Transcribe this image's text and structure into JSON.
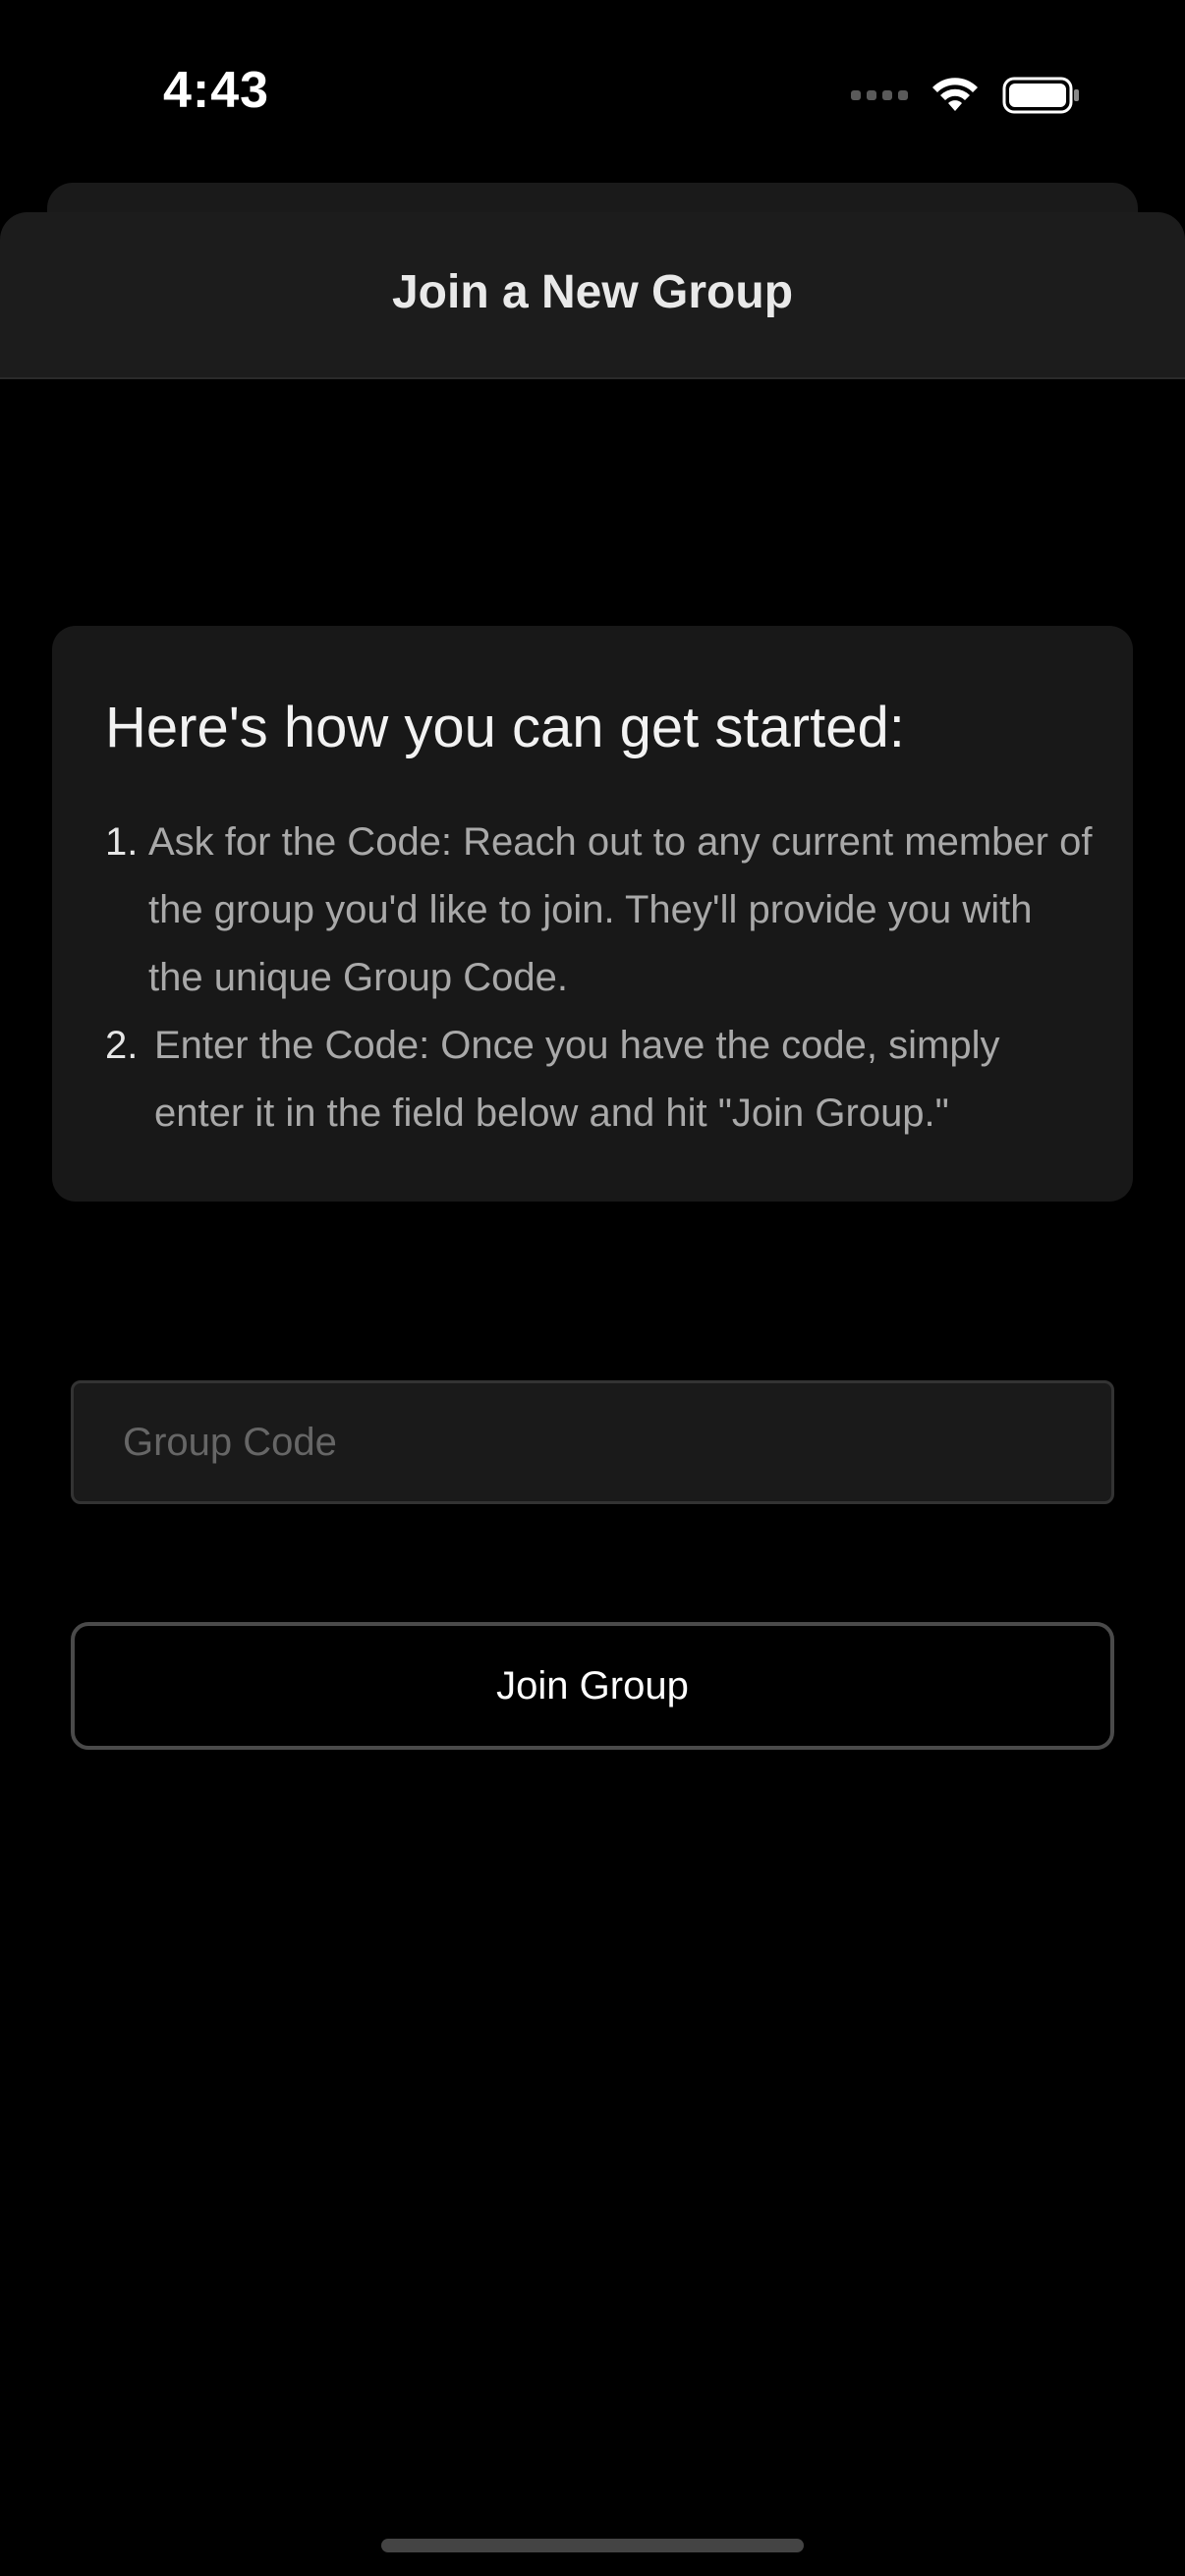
{
  "status_bar": {
    "time": "4:43",
    "icons": [
      "signal-dots-icon",
      "wifi-icon",
      "battery-icon"
    ]
  },
  "sheet": {
    "title": "Join a New Group"
  },
  "info_card": {
    "heading": "Here's how you can get started:",
    "steps": [
      {
        "number": "1.",
        "text": "Ask for the Code: Reach out to any current member of the group you'd like to join. They'll provide you with the unique Group Code."
      },
      {
        "number": "2.",
        "text": "Enter the Code: Once you have the code, simply enter it in the field below and hit \"Join Group.\""
      }
    ]
  },
  "form": {
    "code_input": {
      "value": "",
      "placeholder": "Group Code"
    },
    "join_button_label": "Join Group"
  },
  "colors": {
    "background": "#000000",
    "card": "#181818",
    "header": "#1c1c1c",
    "muted_text": "#a9a9a9",
    "button_border": "#4a4a4a"
  }
}
